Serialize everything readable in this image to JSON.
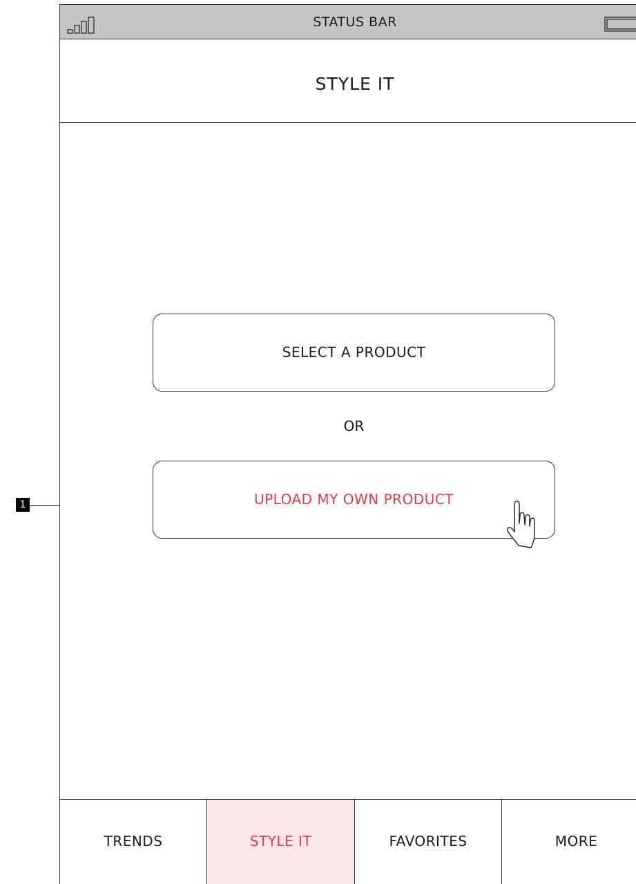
{
  "annotation": {
    "number": "1"
  },
  "status_bar": {
    "title": "STATUS BAR",
    "signal_icon": "signal-bars-icon",
    "battery_icon": "battery-icon"
  },
  "header": {
    "title": "STYLE IT"
  },
  "main": {
    "select_button_label": "SELECT A PRODUCT",
    "or_label": "OR",
    "upload_button_label": "UPLOAD MY OWN PRODUCT",
    "cursor_icon": "hand-pointer-icon"
  },
  "tabs": [
    {
      "label": "TRENDS",
      "active": false
    },
    {
      "label": "STYLE IT",
      "active": true
    },
    {
      "label": "FAVORITES",
      "active": false
    },
    {
      "label": "MORE",
      "active": false
    }
  ],
  "colors": {
    "accent": "#e63946",
    "active_tab_bg": "#fbe7e8",
    "status_bar_bg": "#c4c5c7"
  }
}
